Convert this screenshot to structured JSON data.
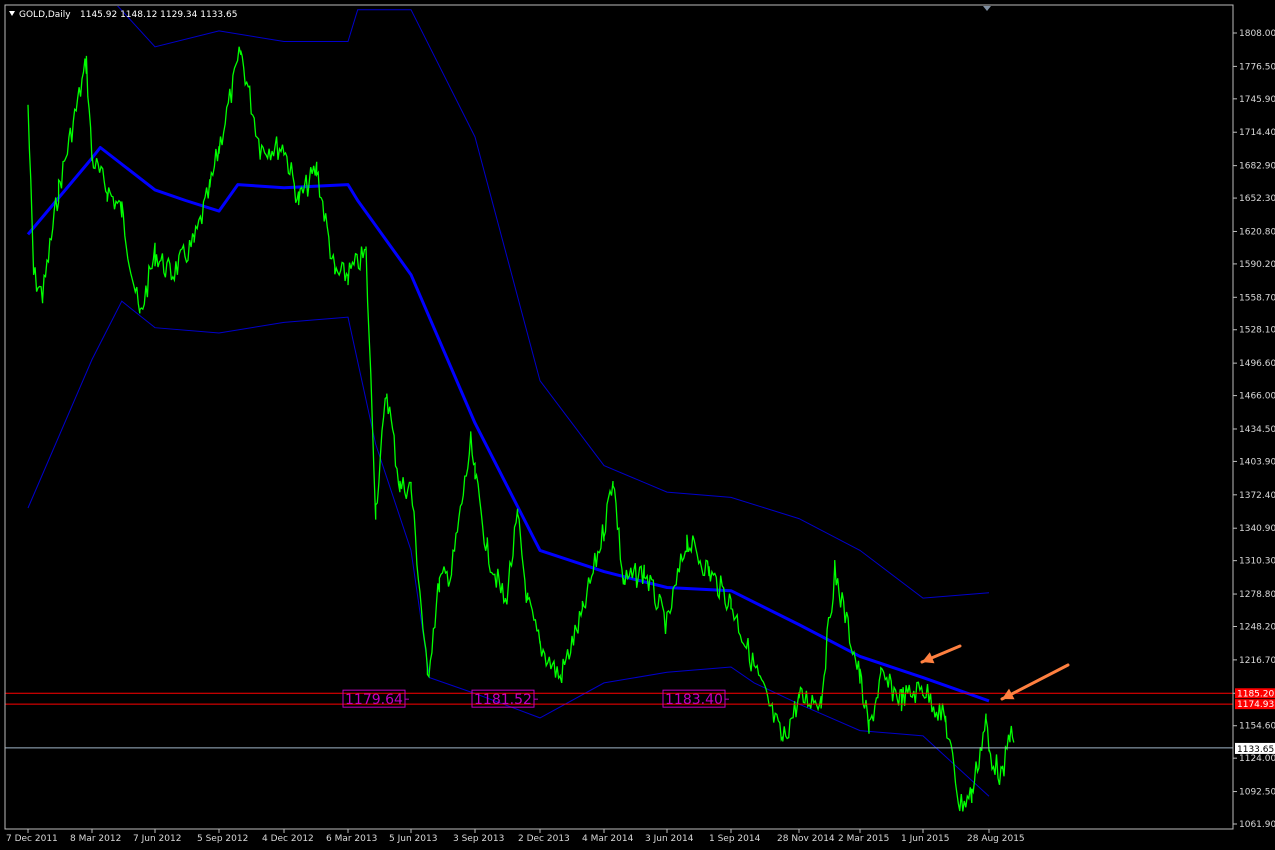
{
  "header": {
    "symbol_text": "GOLD,Daily",
    "ohlc_text": "1145.92 1148.12 1129.34 1133.65"
  },
  "colors": {
    "background": "#000000",
    "price": "#00ff00",
    "middle_band": "#0000ff",
    "outer_bands": "#0000cc",
    "support_lines": "#ff0000",
    "current_price_line": "#9fb5c8",
    "annotation_boxes": "#c000c0",
    "arrows": "#ff8040",
    "axis_text": "#d8d8d8"
  },
  "chart_data": {
    "type": "line",
    "title": "GOLD,Daily",
    "ylim": [
      1061.9,
      1825
    ],
    "y_ticks": [
      "1808.00",
      "1776.50",
      "1745.90",
      "1714.40",
      "1682.90",
      "1652.30",
      "1620.80",
      "1590.20",
      "1558.70",
      "1528.10",
      "1496.60",
      "1466.00",
      "1434.50",
      "1403.90",
      "1372.40",
      "1340.90",
      "1310.30",
      "1278.80",
      "1248.20",
      "1216.70",
      "1185.20",
      "1154.60",
      "1124.00",
      "1092.50",
      "1061.90"
    ],
    "x_ticks": [
      "7 Dec 2011",
      "8 Mar 2012",
      "7 Jun 2012",
      "5 Sep 2012",
      "4 Dec 2012",
      "6 Mar 2013",
      "5 Jun 2013",
      "3 Sep 2013",
      "2 Dec 2013",
      "4 Mar 2014",
      "3 Jun 2014",
      "1 Sep 2014",
      "28 Nov 2014",
      "2 Mar 2015",
      "1 Jun 2015",
      "28 Aug 2015"
    ],
    "price_label": "1133.65",
    "horizontal_levels": [
      {
        "label": "1185.20",
        "value": 1185.2
      },
      {
        "label": "1174.93",
        "value": 1174.93
      }
    ],
    "annotations": [
      {
        "text": "1179.64",
        "x": "5 Jun 2013"
      },
      {
        "text": "1181.52",
        "x": "2 Dec 2013"
      },
      {
        "text": "1183.40",
        "x": "1 Sep 2014"
      }
    ],
    "series": [
      {
        "key": "price",
        "points": [
          [
            "7 Dec 2011",
            1740
          ],
          [
            "15 Dec 2011",
            1580
          ],
          [
            "28 Dec 2011",
            1560
          ],
          [
            "20 Jan 2012",
            1660
          ],
          [
            "29 Feb 2012",
            1780
          ],
          [
            "8 Mar 2012",
            1690
          ],
          [
            "30 Mar 2012",
            1660
          ],
          [
            "20 Apr 2012",
            1640
          ],
          [
            "16 May 2012",
            1540
          ],
          [
            "7 Jun 2012",
            1600
          ],
          [
            "30 Jun 2012",
            1580
          ],
          [
            "1 Aug 2012",
            1610
          ],
          [
            "23 Aug 2012",
            1660
          ],
          [
            "5 Sep 2012",
            1700
          ],
          [
            "5 Oct 2012",
            1790
          ],
          [
            "1 Nov 2012",
            1700
          ],
          [
            "4 Dec 2012",
            1700
          ],
          [
            "25 Dec 2012",
            1650
          ],
          [
            "20 Jan 2013",
            1680
          ],
          [
            "15 Feb 2013",
            1580
          ],
          [
            "6 Mar 2013",
            1580
          ],
          [
            "1 Apr 2013",
            1600
          ],
          [
            "15 Apr 2013",
            1360
          ],
          [
            "1 May 2013",
            1470
          ],
          [
            "20 May 2013",
            1380
          ],
          [
            "5 Jun 2013",
            1380
          ],
          [
            "28 Jun 2013",
            1200
          ],
          [
            "15 Jul 2013",
            1290
          ],
          [
            "1 Aug 2013",
            1300
          ],
          [
            "28 Aug 2013",
            1420
          ],
          [
            "3 Sep 2013",
            1390
          ],
          [
            "20 Sep 2013",
            1320
          ],
          [
            "15 Oct 2013",
            1270
          ],
          [
            "1 Nov 2013",
            1350
          ],
          [
            "15 Nov 2013",
            1270
          ],
          [
            "2 Dec 2013",
            1230
          ],
          [
            "31 Dec 2013",
            1200
          ],
          [
            "1 Feb 2014",
            1260
          ],
          [
            "4 Mar 2014",
            1340
          ],
          [
            "17 Mar 2014",
            1390
          ],
          [
            "1 Apr 2014",
            1290
          ],
          [
            "1 May 2014",
            1300
          ],
          [
            "3 Jun 2014",
            1250
          ],
          [
            "1 Jul 2014",
            1330
          ],
          [
            "1 Aug 2014",
            1300
          ],
          [
            "1 Sep 2014",
            1270
          ],
          [
            "1 Oct 2014",
            1210
          ],
          [
            "7 Nov 2014",
            1140
          ],
          [
            "28 Nov 2014",
            1180
          ],
          [
            "1 Jan 2015",
            1180
          ],
          [
            "22 Jan 2015",
            1300
          ],
          [
            "2 Mar 2015",
            1200
          ],
          [
            "15 Mar 2015",
            1150
          ],
          [
            "1 Apr 2015",
            1200
          ],
          [
            "1 May 2015",
            1180
          ],
          [
            "1 Jun 2015",
            1190
          ],
          [
            "1 Jul 2015",
            1160
          ],
          [
            "20 Jul 2015",
            1080
          ],
          [
            "5 Aug 2015",
            1090
          ],
          [
            "24 Aug 2015",
            1160
          ],
          [
            "28 Aug 2015",
            1130
          ],
          [
            "15 Sep 2015",
            1105
          ],
          [
            "25 Sep 2015",
            1150
          ],
          [
            "30 Sep 2015",
            1133.65
          ]
        ]
      },
      {
        "key": "middle",
        "points": [
          [
            "7 Dec 2011",
            1618
          ],
          [
            "8 Mar 2012",
            1690
          ],
          [
            "20 Mar 2012",
            1700
          ],
          [
            "7 Jun 2012",
            1660
          ],
          [
            "20 Jul 2012",
            1650
          ],
          [
            "5 Sep 2012",
            1640
          ],
          [
            "1 Oct 2012",
            1665
          ],
          [
            "4 Dec 2012",
            1662
          ],
          [
            "6 Mar 2013",
            1665
          ],
          [
            "20 Mar 2013",
            1650
          ],
          [
            "5 Jun 2013",
            1580
          ],
          [
            "3 Sep 2013",
            1440
          ],
          [
            "2 Dec 2013",
            1320
          ],
          [
            "4 Mar 2014",
            1300
          ],
          [
            "3 Jun 2014",
            1285
          ],
          [
            "1 Sep 2014",
            1282
          ],
          [
            "28 Nov 2014",
            1250
          ],
          [
            "2 Mar 2015",
            1220
          ],
          [
            "1 Jun 2015",
            1200
          ],
          [
            "28 Aug 2015",
            1178
          ]
        ]
      },
      {
        "key": "upper",
        "points": [
          [
            "7 Dec 2011",
            1880
          ],
          [
            "8 Mar 2012",
            1860
          ],
          [
            "7 Jun 2012",
            1795
          ],
          [
            "5 Sep 2012",
            1810
          ],
          [
            "4 Dec 2012",
            1800
          ],
          [
            "6 Mar 2013",
            1800
          ],
          [
            "20 Mar 2013",
            1830
          ],
          [
            "5 Jun 2013",
            1830
          ],
          [
            "3 Sep 2013",
            1710
          ],
          [
            "2 Dec 2013",
            1480
          ],
          [
            "4 Mar 2014",
            1400
          ],
          [
            "3 Jun 2014",
            1375
          ],
          [
            "1 Sep 2014",
            1370
          ],
          [
            "28 Nov 2014",
            1350
          ],
          [
            "2 Mar 2015",
            1320
          ],
          [
            "1 Jun 2015",
            1275
          ],
          [
            "28 Aug 2015",
            1280
          ]
        ]
      },
      {
        "key": "lower",
        "points": [
          [
            "7 Dec 2011",
            1360
          ],
          [
            "8 Mar 2012",
            1500
          ],
          [
            "20 Apr 2012",
            1555
          ],
          [
            "7 Jun 2012",
            1530
          ],
          [
            "5 Sep 2012",
            1525
          ],
          [
            "4 Dec 2012",
            1535
          ],
          [
            "6 Mar 2013",
            1540
          ],
          [
            "15 Apr 2013",
            1420
          ],
          [
            "5 Jun 2013",
            1320
          ],
          [
            "1 Jul 2013",
            1200
          ],
          [
            "3 Sep 2013",
            1185
          ],
          [
            "2 Dec 2013",
            1162
          ],
          [
            "4 Mar 2014",
            1195
          ],
          [
            "3 Jun 2014",
            1205
          ],
          [
            "1 Sep 2014",
            1210
          ],
          [
            "1 Oct 2014",
            1195
          ],
          [
            "28 Nov 2014",
            1175
          ],
          [
            "2 Mar 2015",
            1150
          ],
          [
            "1 Jun 2015",
            1145
          ],
          [
            "28 Aug 2015",
            1088
          ]
        ]
      }
    ]
  }
}
